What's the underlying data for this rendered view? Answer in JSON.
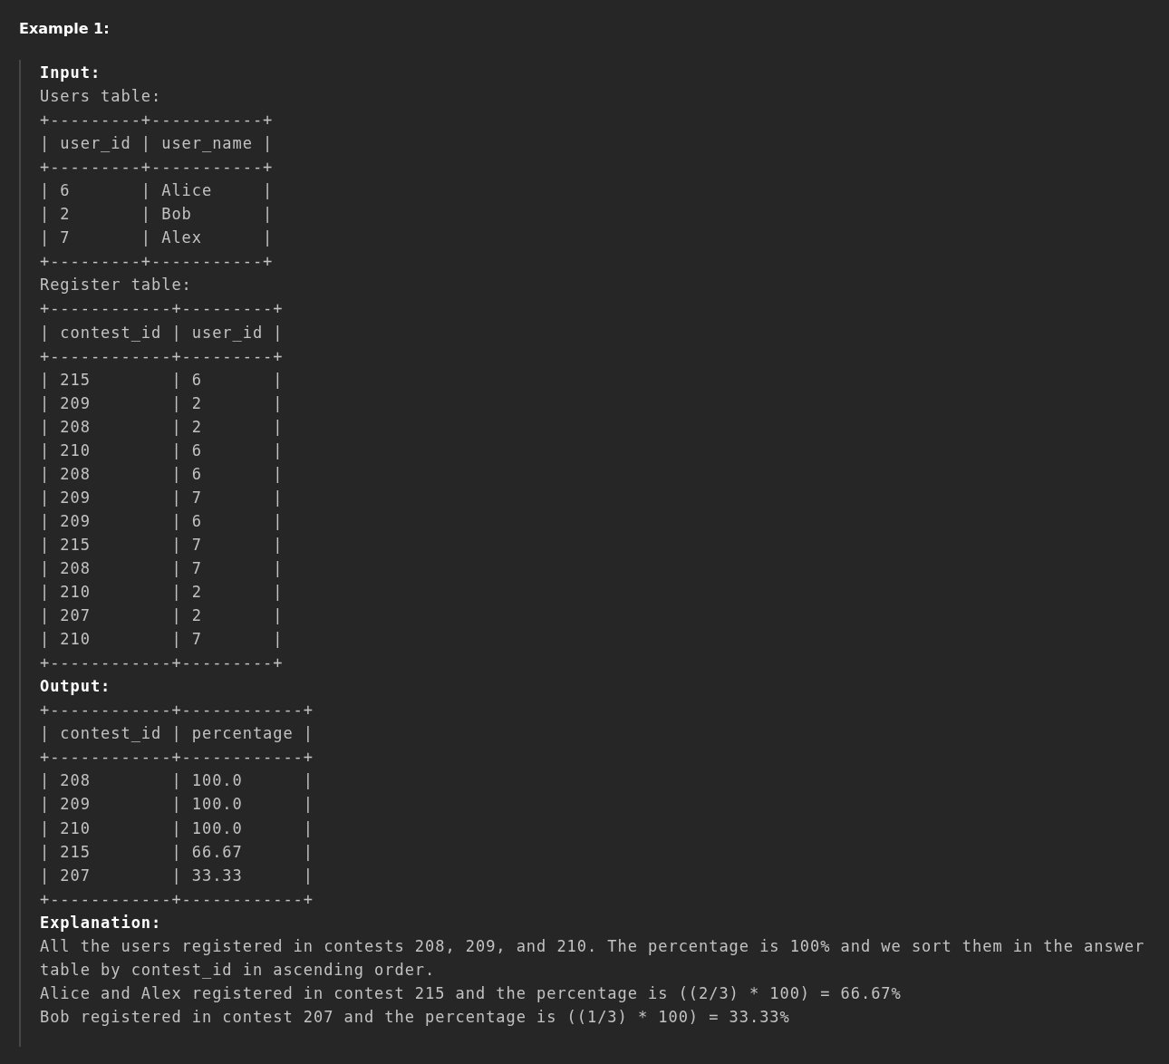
{
  "heading": "Example 1:",
  "lines": [
    {
      "kind": "label",
      "text": "Input:"
    },
    {
      "kind": "text",
      "text": "Users table:"
    },
    {
      "kind": "text",
      "text": "+---------+-----------+"
    },
    {
      "kind": "text",
      "text": "| user_id | user_name |"
    },
    {
      "kind": "text",
      "text": "+---------+-----------+"
    },
    {
      "kind": "text",
      "text": "| 6       | Alice     |"
    },
    {
      "kind": "text",
      "text": "| 2       | Bob       |"
    },
    {
      "kind": "text",
      "text": "| 7       | Alex      |"
    },
    {
      "kind": "text",
      "text": "+---------+-----------+"
    },
    {
      "kind": "text",
      "text": "Register table:"
    },
    {
      "kind": "text",
      "text": "+------------+---------+"
    },
    {
      "kind": "text",
      "text": "| contest_id | user_id |"
    },
    {
      "kind": "text",
      "text": "+------------+---------+"
    },
    {
      "kind": "text",
      "text": "| 215        | 6       |"
    },
    {
      "kind": "text",
      "text": "| 209        | 2       |"
    },
    {
      "kind": "text",
      "text": "| 208        | 2       |"
    },
    {
      "kind": "text",
      "text": "| 210        | 6       |"
    },
    {
      "kind": "text",
      "text": "| 208        | 6       |"
    },
    {
      "kind": "text",
      "text": "| 209        | 7       |"
    },
    {
      "kind": "text",
      "text": "| 209        | 6       |"
    },
    {
      "kind": "text",
      "text": "| 215        | 7       |"
    },
    {
      "kind": "text",
      "text": "| 208        | 7       |"
    },
    {
      "kind": "text",
      "text": "| 210        | 2       |"
    },
    {
      "kind": "text",
      "text": "| 207        | 2       |"
    },
    {
      "kind": "text",
      "text": "| 210        | 7       |"
    },
    {
      "kind": "text",
      "text": "+------------+---------+"
    },
    {
      "kind": "label",
      "text": "Output:"
    },
    {
      "kind": "text",
      "text": "+------------+------------+"
    },
    {
      "kind": "text",
      "text": "| contest_id | percentage |"
    },
    {
      "kind": "text",
      "text": "+------------+------------+"
    },
    {
      "kind": "text",
      "text": "| 208        | 100.0      |"
    },
    {
      "kind": "text",
      "text": "| 209        | 100.0      |"
    },
    {
      "kind": "text",
      "text": "| 210        | 100.0      |"
    },
    {
      "kind": "text",
      "text": "| 215        | 66.67      |"
    },
    {
      "kind": "text",
      "text": "| 207        | 33.33      |"
    },
    {
      "kind": "text",
      "text": "+------------+------------+"
    },
    {
      "kind": "label",
      "text": "Explanation:"
    },
    {
      "kind": "text",
      "text": "All the users registered in contests 208, 209, and 210. The percentage is 100% and we sort them in the answer table by contest_id in ascending order."
    },
    {
      "kind": "text",
      "text": "Alice and Alex registered in contest 215 and the percentage is ((2/3) * 100) = 66.67%"
    },
    {
      "kind": "text",
      "text": "Bob registered in contest 207 and the percentage is ((1/3) * 100) = 33.33%"
    }
  ]
}
